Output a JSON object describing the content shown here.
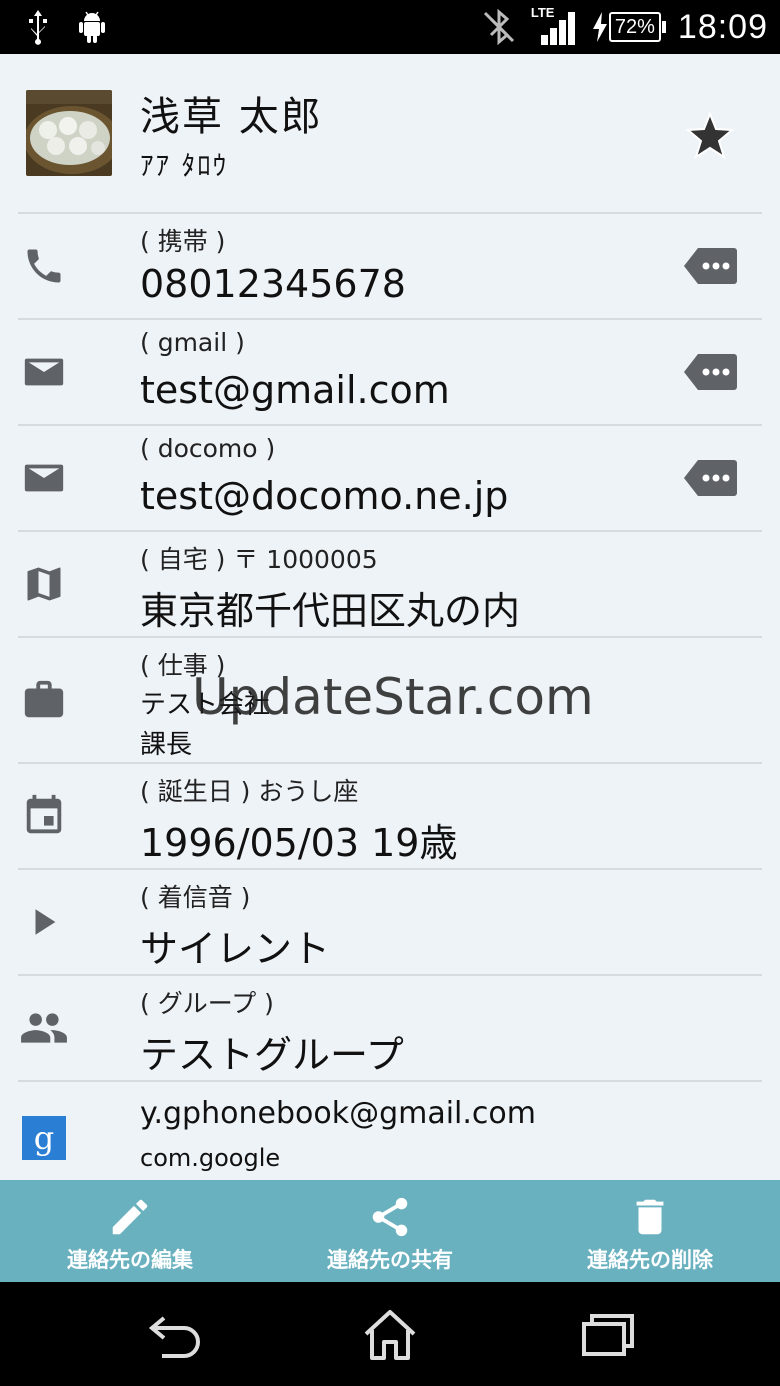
{
  "status_bar": {
    "network": "LTE",
    "battery": "72%",
    "time": "18:09"
  },
  "contact": {
    "name": "浅草  太郎",
    "kana": "ｱｱ ﾀﾛｳ",
    "favorite": true
  },
  "fields": {
    "phone": {
      "label": "( 携帯 )",
      "value": "08012345678"
    },
    "email1": {
      "label": "( gmail )",
      "value": "test@gmail.com"
    },
    "email2": {
      "label": "( docomo )",
      "value": "test@docomo.ne.jp"
    },
    "address": {
      "label": "( 自宅 )  〒 1000005",
      "value": "東京都千代田区丸の内"
    },
    "work": {
      "label": "( 仕事 )",
      "company": "テスト会社",
      "title": "課長"
    },
    "birthday": {
      "label": "( 誕生日 )    おうし座",
      "value": "1996/05/03    19歳"
    },
    "ringtone": {
      "label": "( 着信音 )",
      "value": "サイレント"
    },
    "group": {
      "label": "( グループ )",
      "value": "テストグループ"
    },
    "account": {
      "email": "y.gphonebook@gmail.com",
      "type": "com.google"
    }
  },
  "watermark": "UpdateStar.com",
  "actions": {
    "edit": "連絡先の編集",
    "share": "連絡先の共有",
    "delete": "連絡先の削除"
  },
  "colors": {
    "action_bar": "#6ab1c0",
    "background": "#eef3f8",
    "icon": "#5f6368"
  }
}
